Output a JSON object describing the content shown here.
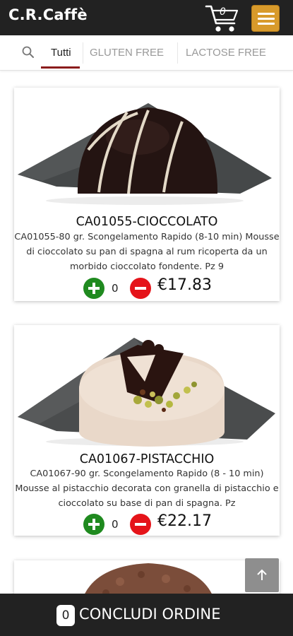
{
  "header": {
    "brand": "C.R.Caffè",
    "cart_count": "0",
    "brand_color": "#222222",
    "menu_color": "#d89a2b"
  },
  "filters": {
    "tabs": [
      {
        "label": "Tutti",
        "active": true
      },
      {
        "label": "GLUTEN FREE",
        "active": false
      },
      {
        "label": "LACTOSE FREE",
        "active": false
      }
    ],
    "active_color": "#8b1c1c"
  },
  "products": [
    {
      "title": "CA01055-CIOCCOLATO",
      "description": "CA01055-80 gr. Scongelamento Rapido (8-10 min) Mousse di cioccolato su pan di spagna al rum ricoperta da un morbido cioccolato fondente. Pz 9",
      "quantity": "0",
      "price": "€17.83"
    },
    {
      "title": "CA01067-PISTACCHIO",
      "description": "CA01067-90 gr. Scongelamento Rapido (8 - 10 min) Mousse al pistacchio decorata con granella di pistacchio e cioccolato su base di pan di spagna. Pz",
      "quantity": "0",
      "price": "€22.17"
    }
  ],
  "footer": {
    "order_count": "0",
    "order_label": "CONCLUDI ORDINE"
  },
  "colors": {
    "plus": "#1f8a1f",
    "minus": "#e5141a"
  }
}
